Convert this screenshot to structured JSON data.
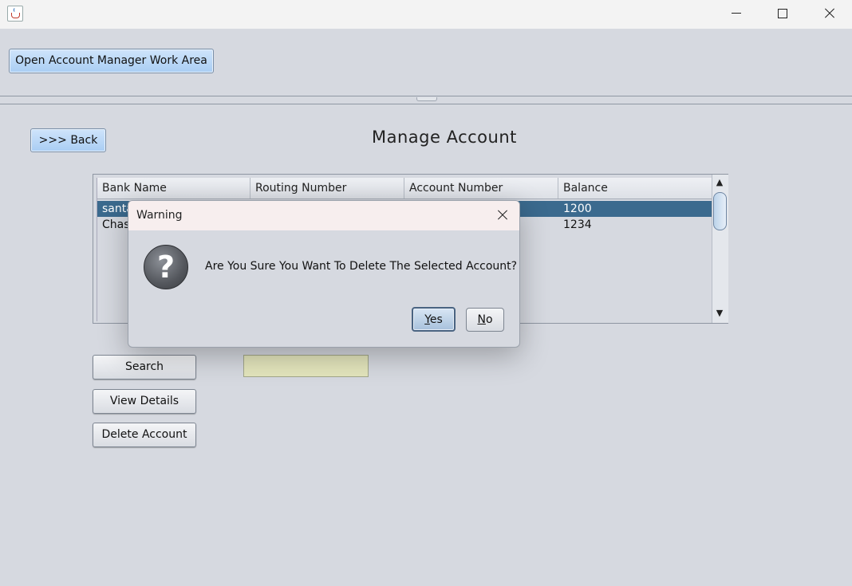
{
  "window": {
    "title": ""
  },
  "top": {
    "open_button": "Open Account Manager Work Area"
  },
  "page": {
    "back_button": ">>> Back",
    "title": "Manage Account"
  },
  "table": {
    "columns": [
      "Bank Name",
      "Routing Number",
      "Account Number",
      "Balance"
    ],
    "rows": [
      {
        "bank": "santa",
        "routing": "",
        "account": "",
        "balance": "1200",
        "selected": true
      },
      {
        "bank": "Chas",
        "routing": "",
        "account": "",
        "balance": "1234",
        "selected": false
      }
    ]
  },
  "actions": {
    "search": "Search",
    "view_details": "View Details",
    "delete_account": "Delete Account"
  },
  "search": {
    "value": ""
  },
  "dialog": {
    "title": "Warning",
    "icon": "question-icon",
    "message": "Are You Sure You Want To Delete The Selected Account?",
    "yes_mnemonic": "Y",
    "yes_rest": "es",
    "no_mnemonic": "N",
    "no_rest": "o"
  },
  "colors": {
    "selection": "#3b6a8e",
    "search_field": "#e4e6bd",
    "dialog_title_bar": "#f7eeee"
  }
}
